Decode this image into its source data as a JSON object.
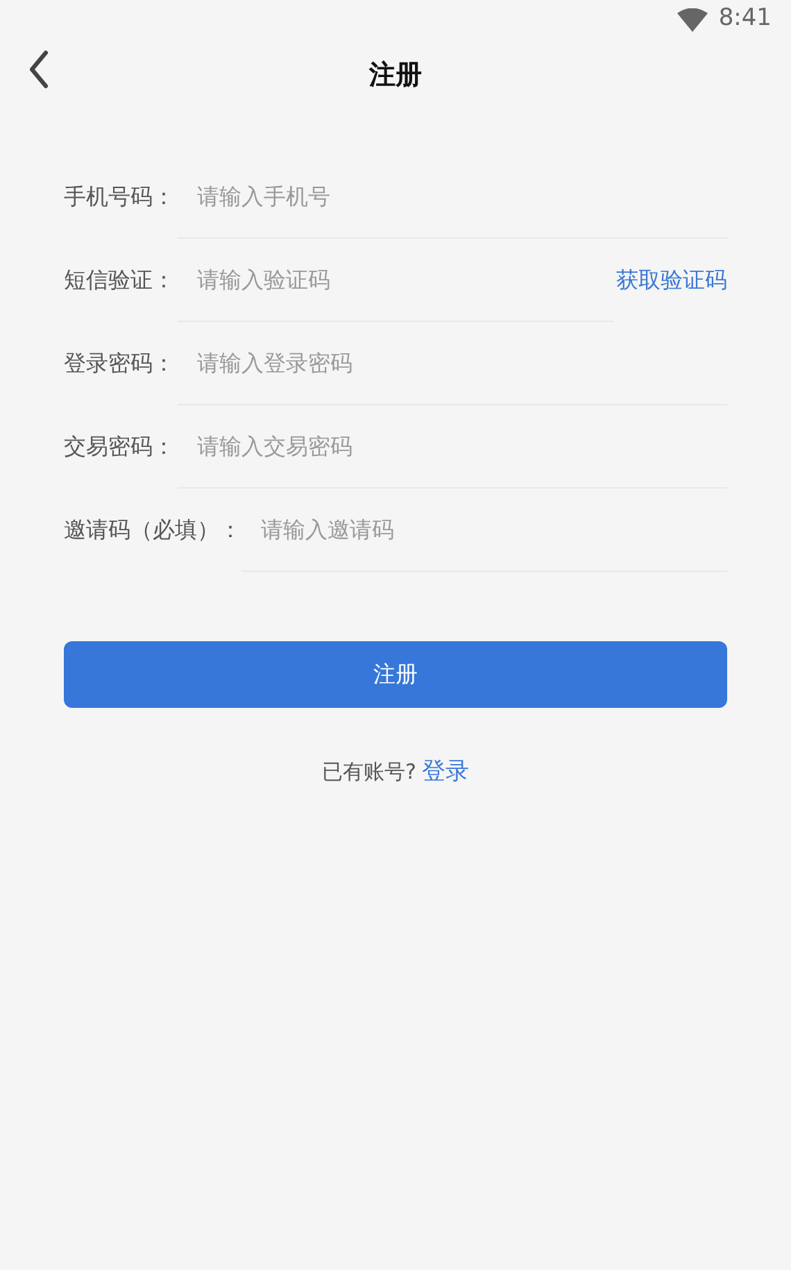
{
  "status_bar": {
    "time": "8:41"
  },
  "header": {
    "title": "注册"
  },
  "fields": [
    {
      "kind": "text",
      "label": "手机号码：",
      "placeholder": "请输入手机号"
    },
    {
      "kind": "sms",
      "label": "短信验证：",
      "placeholder": "请输入验证码",
      "action": "获取验证码"
    },
    {
      "kind": "text",
      "label": "登录密码：",
      "placeholder": "请输入登录密码"
    },
    {
      "kind": "text",
      "label": "交易密码：",
      "placeholder": "请输入交易密码"
    },
    {
      "kind": "text",
      "label": "邀请码（必填）：",
      "placeholder": "请输入邀请码"
    }
  ],
  "submit": "注册",
  "footer": {
    "prompt": "已有账号?",
    "link": "登录"
  }
}
